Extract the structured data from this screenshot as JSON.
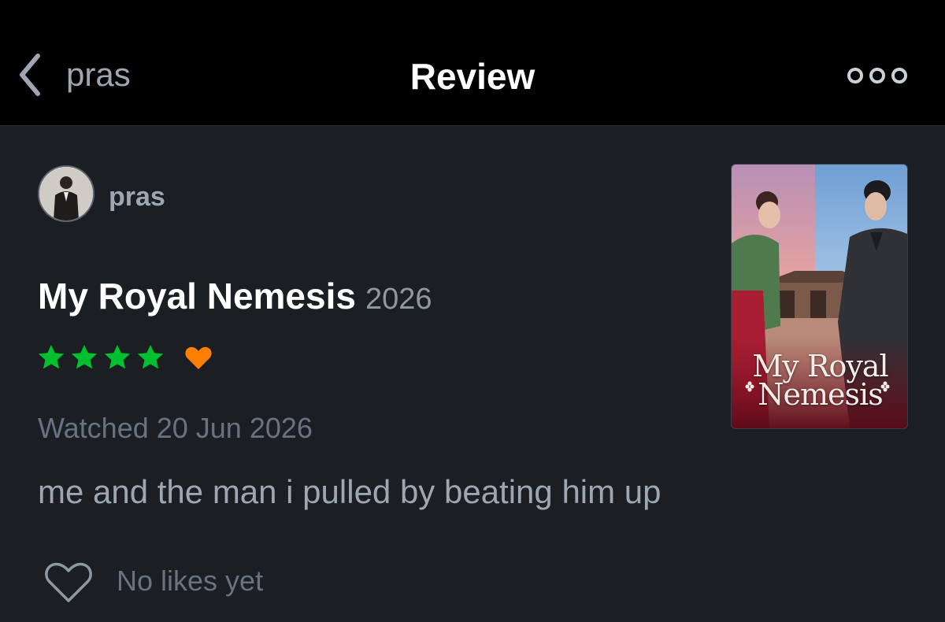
{
  "header": {
    "back_label": "pras",
    "title": "Review"
  },
  "review": {
    "username": "pras",
    "film_title": "My Royal Nemesis",
    "film_year": "2026",
    "rating_stars": 4,
    "rating_max": 5,
    "liked": true,
    "watched_text": "Watched 20 Jun 2026",
    "body": "me and the man i pulled by beating him up",
    "likes_text": "No likes yet"
  },
  "poster": {
    "title_line1": "My Royal",
    "title_line2": "Nemesis"
  },
  "icons": {
    "back": "chevron-left-icon",
    "more": "more-options-icon",
    "star": "star-icon",
    "liked": "heart-filled-icon",
    "like": "heart-outline-icon"
  },
  "colors": {
    "star": "#00c030",
    "liked_heart": "#ff8000",
    "background": "#1b1e23",
    "header_background": "#000000"
  }
}
